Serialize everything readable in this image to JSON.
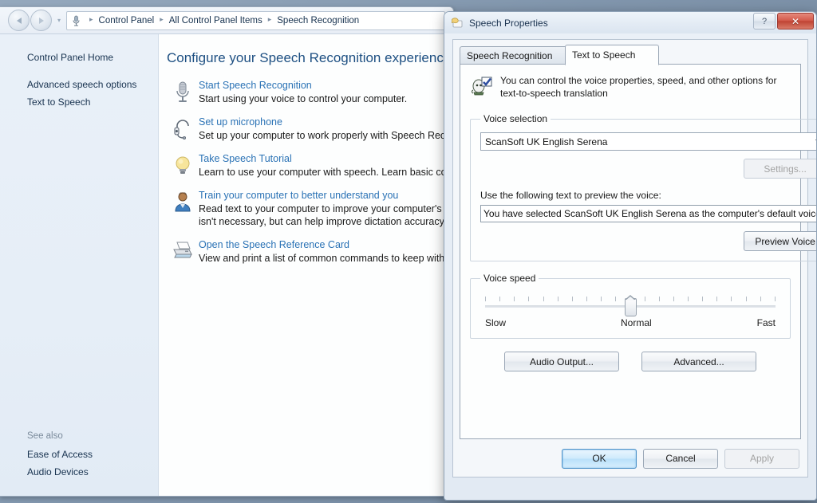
{
  "control_panel": {
    "address": {
      "icon": "microphone-icon",
      "crumbs": [
        "Control Panel",
        "All Control Panel Items",
        "Speech Recognition"
      ],
      "separator": "▸"
    },
    "sidebar": {
      "home_label": "Control Panel Home",
      "items": [
        {
          "label": "Advanced speech options"
        },
        {
          "label": "Text to Speech"
        }
      ],
      "see_also_title": "See also",
      "see_also_items": [
        {
          "label": "Ease of Access"
        },
        {
          "label": "Audio Devices"
        }
      ]
    },
    "main": {
      "heading": "Configure your Speech Recognition experience",
      "tasks": [
        {
          "icon": "microphone-icon",
          "link": "Start Speech Recognition",
          "desc": "Start using your voice to control your computer."
        },
        {
          "icon": "headset-icon",
          "link": "Set up microphone",
          "desc": "Set up your computer to work properly with Speech Reco"
        },
        {
          "icon": "lightbulb-icon",
          "link": "Take Speech Tutorial",
          "desc": "Learn to use your computer with speech.  Learn basic cor"
        },
        {
          "icon": "user-icon",
          "link": "Train your computer to better understand you",
          "desc": "Read text to your computer to improve your computer's ",
          "desc2": "isn't necessary, but can help improve dictation accuracy."
        },
        {
          "icon": "printer-icon",
          "link": "Open the Speech Reference Card",
          "desc": "View and print a list of common commands to keep with"
        }
      ]
    }
  },
  "dialog": {
    "title": "Speech Properties",
    "title_icon": "speech-properties-icon",
    "help_button": "?",
    "close_button": "✕",
    "tabs": [
      {
        "label": "Speech Recognition",
        "active": false
      },
      {
        "label": "Text to Speech",
        "active": true
      }
    ],
    "intro": {
      "icon": "speaker-check-icon",
      "line1": "You can control the voice properties, speed, and other options for",
      "line2": "text-to-speech translation"
    },
    "voice_selection": {
      "legend": "Voice selection",
      "selected_voice": "ScanSoft UK English Serena",
      "dropdown_icon": "chevron-down-icon",
      "settings_label": "Settings...",
      "settings_disabled": true,
      "preview_label": "Use the following text to preview the voice:",
      "preview_text": "You have selected ScanSoft UK English Serena as the computer's default voice.",
      "preview_button": "Preview Voice"
    },
    "voice_speed": {
      "legend": "Voice speed",
      "tick_count": 21,
      "value_index": 10,
      "slow_label": "Slow",
      "normal_label": "Normal",
      "fast_label": "Fast"
    },
    "extra_buttons": {
      "audio_output": "Audio Output...",
      "advanced": "Advanced..."
    },
    "footer": {
      "ok": "OK",
      "cancel": "Cancel",
      "apply": "Apply",
      "apply_disabled": true
    }
  },
  "colors": {
    "link": "#2a72b5",
    "heading": "#1d4f82",
    "close_red": "#c94a38",
    "default_button_border": "#4a90c8"
  }
}
